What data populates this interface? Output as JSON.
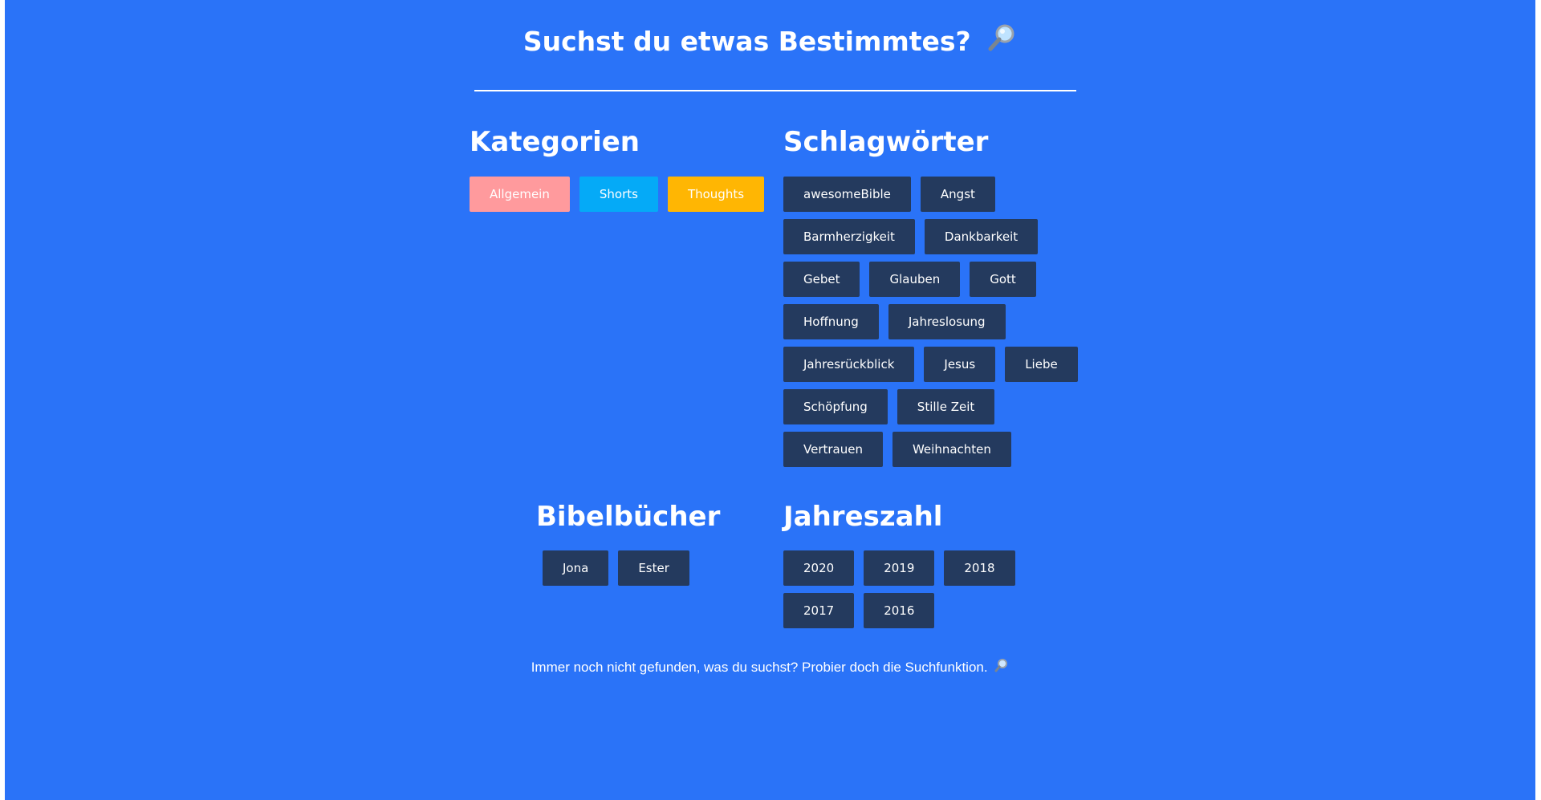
{
  "header": {
    "title": "Suchst du etwas Bestimmtes?",
    "title_icon": "magnifying-glass-icon"
  },
  "categories": {
    "heading": "Kategorien",
    "items": [
      {
        "label": "Allgemein",
        "color": "#ff9a9d"
      },
      {
        "label": "Shorts",
        "color": "#05aaf7"
      },
      {
        "label": "Thoughts",
        "color": "#ffb603"
      }
    ]
  },
  "tags": {
    "heading": "Schlagwörter",
    "color": "#243a5e",
    "items": [
      "awesomeBible",
      "Angst",
      "Barmherzigkeit",
      "Dankbarkeit",
      "Gebet",
      "Glauben",
      "Gott",
      "Hoffnung",
      "Jahreslosung",
      "Jahresrückblick",
      "Jesus",
      "Liebe",
      "Schöpfung",
      "Stille Zeit",
      "Vertrauen",
      "Weihnachten"
    ]
  },
  "books": {
    "heading": "Bibelbücher",
    "items": [
      "Jona",
      "Ester"
    ]
  },
  "years": {
    "heading": "Jahreszahl",
    "items": [
      "2020",
      "2019",
      "2018",
      "2017",
      "2016"
    ]
  },
  "footer": {
    "text": "Immer noch nicht gefunden, was du suchst? Probier doch die Suchfunktion.",
    "icon": "magnifying-glass-icon"
  },
  "colors": {
    "background": "#2a73f8",
    "text": "#ffffff"
  }
}
